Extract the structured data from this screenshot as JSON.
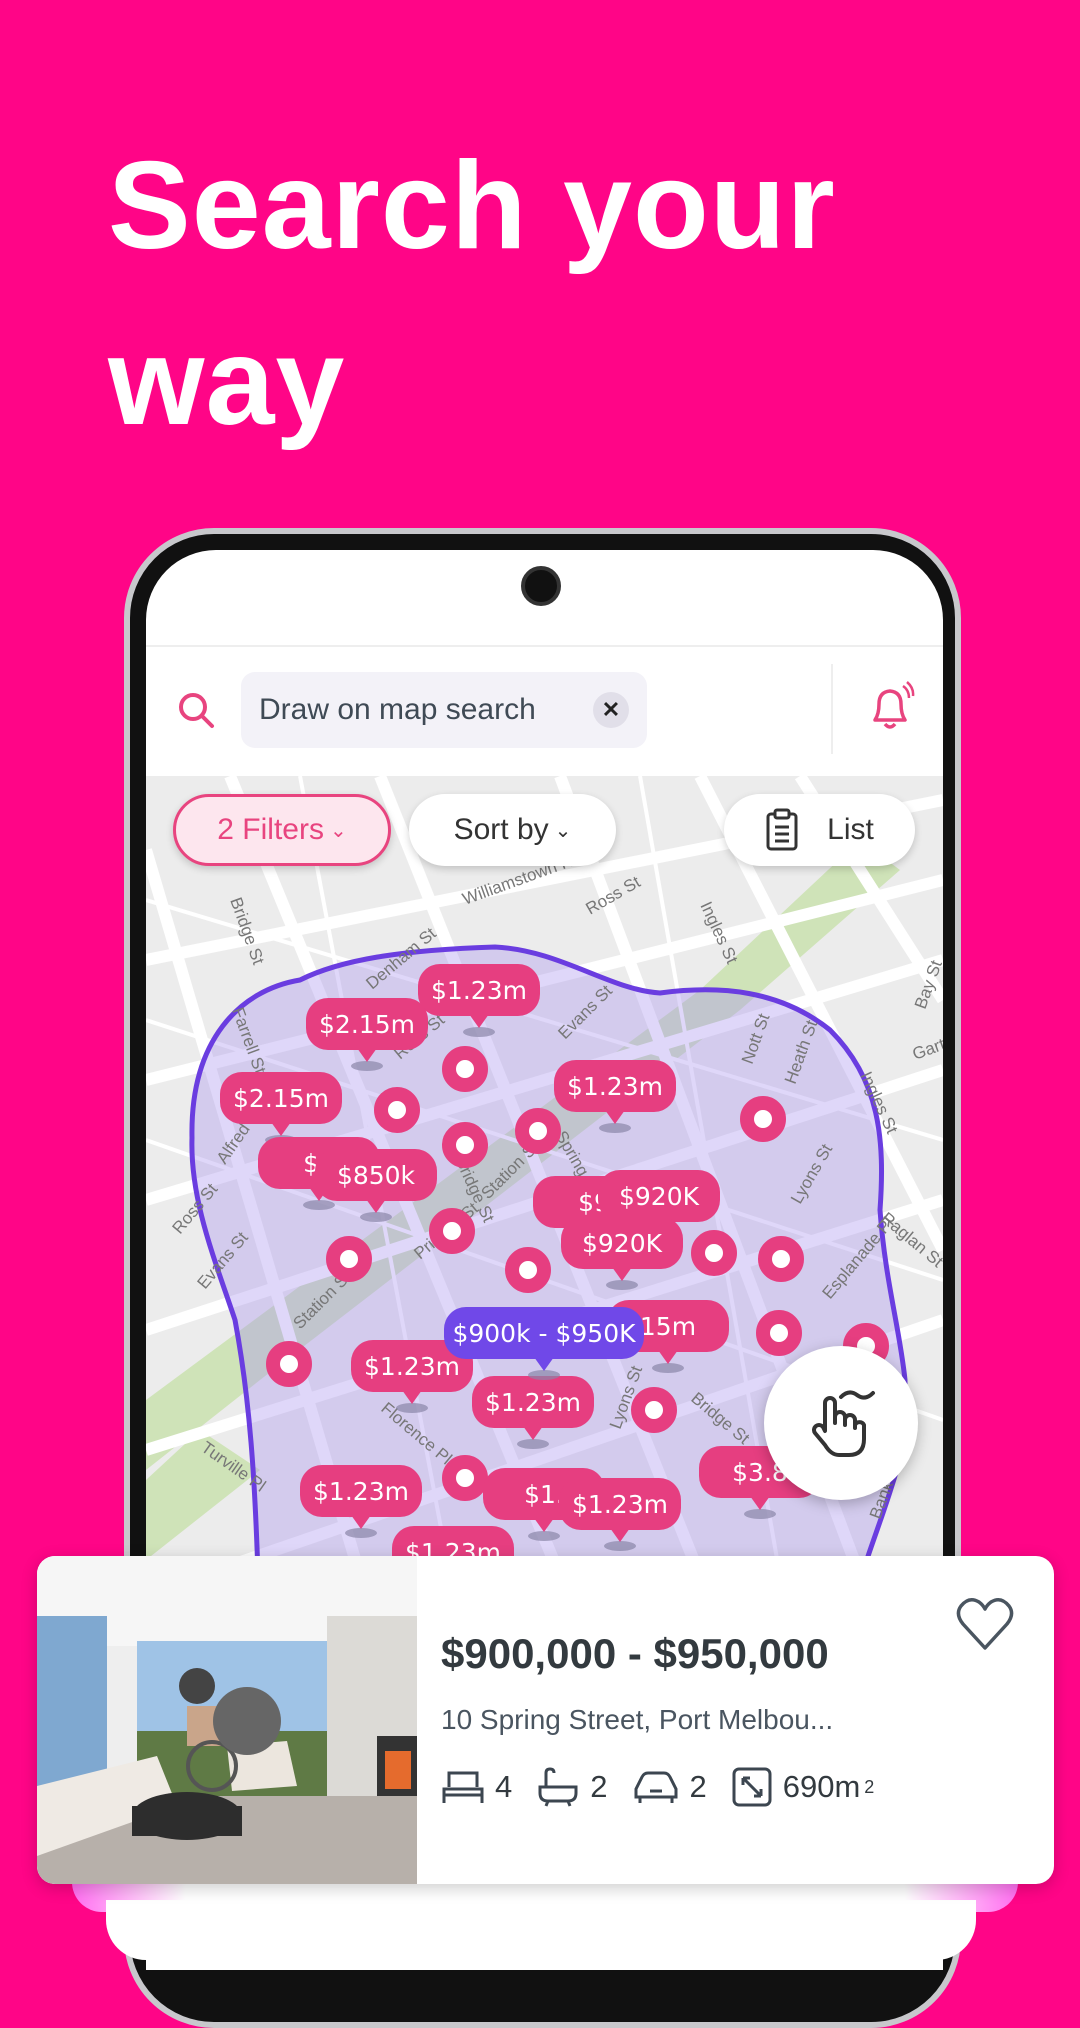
{
  "headline": {
    "line1": "Search your",
    "line2": "way"
  },
  "search": {
    "value": "Draw on map search",
    "clear_icon": "close-icon"
  },
  "toolbar": {
    "filters_label": "2 Filters",
    "sort_label": "Sort by",
    "list_label": "List"
  },
  "map": {
    "streets": [
      "Williamstown Rd",
      "Ross St",
      "Bridge St",
      "Denham St",
      "Farrell St",
      "Ross St",
      "Evans St",
      "Alfred St",
      "Ross St",
      "Evans St",
      "Bridge St",
      "Station St",
      "Spring St",
      "Princes St",
      "Station St",
      "Nott St",
      "Heath St",
      "Ingles St",
      "Ingles St",
      "Bay St",
      "Garton",
      "Raglan St",
      "Lyons St",
      "Esplanade Pl",
      "Florence Pl",
      "Turville Pl",
      "Bridge St",
      "Lyons St",
      "Bank St"
    ],
    "price_pins": [
      "$1.23m",
      "$2.15m",
      "$2.15m",
      "$1.23m",
      "$9",
      "$850k",
      "$9",
      "$920K",
      "$920K",
      "15m",
      "$1.23m",
      "$1.23m",
      "$1.23m",
      "$1.",
      "$1.23m",
      "$3.8",
      "$1.23m"
    ],
    "selected_pin": "$900k - $950K",
    "colors": {
      "pin": "#E63E80",
      "selected": "#7048E8",
      "area_stroke": "#6A3DE0"
    }
  },
  "listing": {
    "price": "$900,000 - $950,000",
    "address": "10 Spring Street, Port Melbou...",
    "beds": "4",
    "baths": "2",
    "cars": "2",
    "area": "690m",
    "area_unit_sup": "2"
  },
  "colors": {
    "background": "#FF0587",
    "accent": "#E8447F"
  }
}
